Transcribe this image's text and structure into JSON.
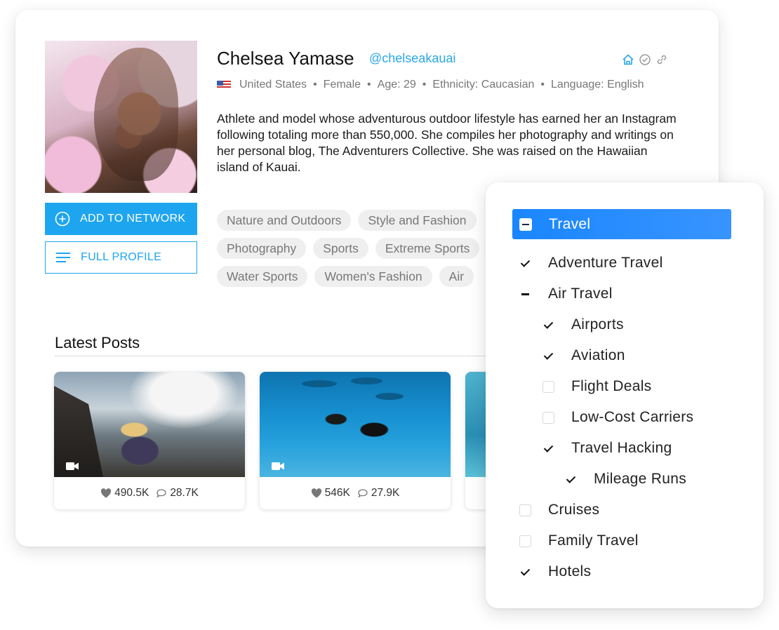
{
  "profile": {
    "name": "Chelsea Yamase",
    "handle": "@chelseakauai",
    "country": "United States",
    "gender": "Female",
    "age": "Age: 29",
    "ethnicity": "Ethnicity: Caucasian",
    "language": "Language: English",
    "bio": "Athlete and model whose adventurous outdoor lifestyle has earned her an Instagram following totaling more than 550,000. She compiles her photography and writings on her personal blog, The Adventurers Collective. She was raised on the Hawaiian island of Kauai.",
    "meta_separator": "•"
  },
  "buttons": {
    "add_to_network": "ADD TO NETWORK",
    "full_profile": "FULL PROFILE"
  },
  "tags": [
    [
      "Nature and Outdoors",
      "Style and Fashion"
    ],
    [
      "Photography",
      "Sports",
      "Extreme Sports"
    ],
    [
      "Water Sports",
      "Women's Fashion",
      "Air"
    ]
  ],
  "latest_posts": {
    "title": "Latest Posts",
    "posts": [
      {
        "likes": "490.5K",
        "comments": "28.7K"
      },
      {
        "likes": "546K",
        "comments": "27.9K"
      }
    ]
  },
  "category_panel": {
    "header": {
      "label": "Travel",
      "state": "partial"
    },
    "options": [
      {
        "label": "Adventure Travel",
        "state": "checked",
        "level": 0
      },
      {
        "label": "Air Travel",
        "state": "partial",
        "level": 0
      },
      {
        "label": "Airports",
        "state": "checked",
        "level": 1
      },
      {
        "label": "Aviation",
        "state": "checked",
        "level": 1
      },
      {
        "label": "Flight Deals",
        "state": "unchecked",
        "level": 1
      },
      {
        "label": "Low-Cost Carriers",
        "state": "unchecked",
        "level": 1
      },
      {
        "label": "Travel Hacking",
        "state": "checked",
        "level": 1
      },
      {
        "label": "Mileage Runs",
        "state": "checked",
        "level": 2
      },
      {
        "label": "Cruises",
        "state": "unchecked",
        "level": 0
      },
      {
        "label": "Family Travel",
        "state": "unchecked",
        "level": 0
      },
      {
        "label": "Hotels",
        "state": "checked",
        "level": 0
      }
    ]
  },
  "colors": {
    "accent": "#1ea5f0",
    "panel_header": "#1a86ff",
    "tag_bg": "#efefef"
  },
  "icons": [
    "plus-circle-icon",
    "list-icon",
    "home-icon",
    "verified-icon",
    "link-icon",
    "heart-icon",
    "comment-icon",
    "video-camera-icon"
  ]
}
